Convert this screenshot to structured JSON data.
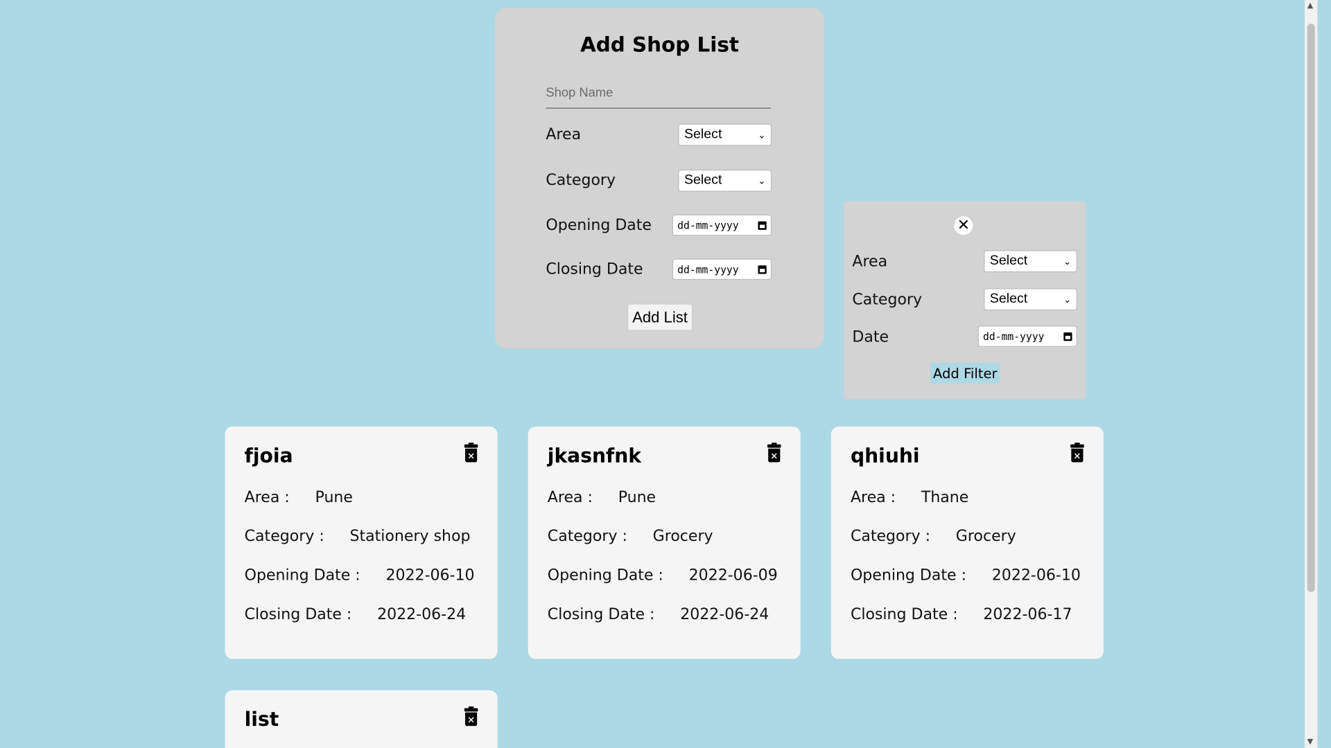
{
  "add_form": {
    "title": "Add Shop List",
    "shop_name_placeholder": "Shop Name",
    "area_label": "Area",
    "area_value": "Select",
    "category_label": "Category",
    "category_value": "Select",
    "opening_date_label": "Opening Date",
    "opening_date_value": "dd-mm-yyyy",
    "closing_date_label": "Closing Date",
    "closing_date_value": "dd-mm-yyyy",
    "submit_label": "Add List"
  },
  "filter": {
    "close_label": "✕",
    "area_label": "Area",
    "area_value": "Select",
    "category_label": "Category",
    "category_value": "Select",
    "date_label": "Date",
    "date_value": "dd-mm-yyyy",
    "submit_label": "Add Filter"
  },
  "cards": [
    {
      "name": "fjoia",
      "area_label": "Area :",
      "area": "Pune",
      "category_label": "Category :",
      "category": "Stationery shop",
      "opening_label": "Opening Date :",
      "opening": "2022-06-10",
      "closing_label": "Closing Date :",
      "closing": "2022-06-24"
    },
    {
      "name": "jkasnfnk",
      "area_label": "Area :",
      "area": "Pune",
      "category_label": "Category :",
      "category": "Grocery",
      "opening_label": "Opening Date :",
      "opening": "2022-06-09",
      "closing_label": "Closing Date :",
      "closing": "2022-06-24"
    },
    {
      "name": "qhiuhi",
      "area_label": "Area :",
      "area": "Thane",
      "category_label": "Category :",
      "category": "Grocery",
      "opening_label": "Opening Date :",
      "opening": "2022-06-10",
      "closing_label": "Closing Date :",
      "closing": "2022-06-17"
    },
    {
      "name": "list"
    }
  ]
}
